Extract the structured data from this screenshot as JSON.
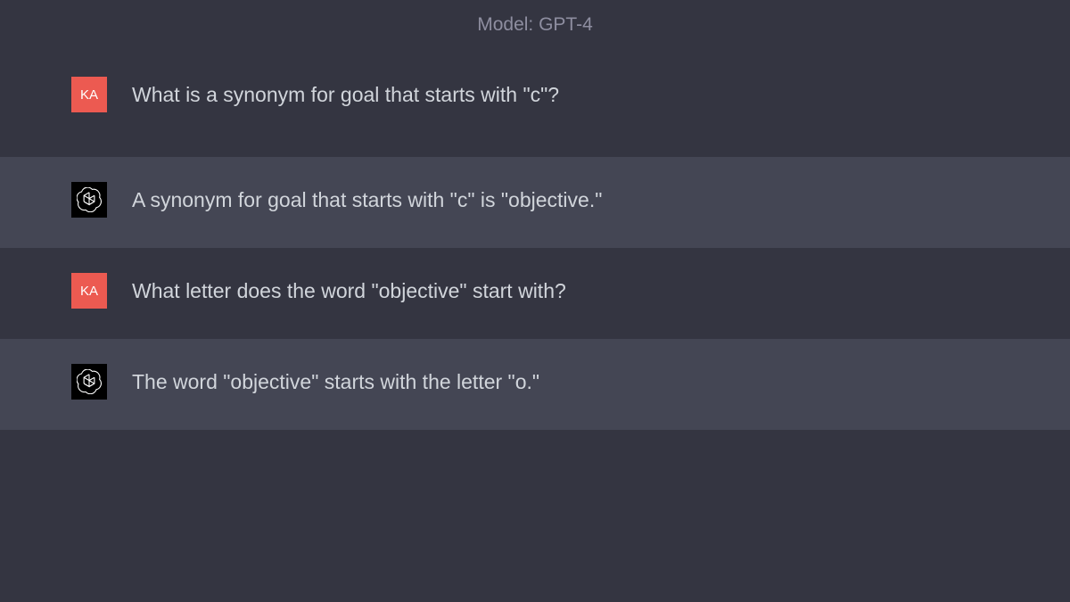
{
  "header": {
    "model_label": "Model: GPT-4"
  },
  "messages": [
    {
      "role": "user",
      "avatar_text": "KA",
      "text": "What is a synonym for goal that starts with \"c\"?"
    },
    {
      "role": "assistant",
      "avatar_icon": "openai-icon",
      "text": "A synonym for goal that starts with \"c\" is \"objective.\""
    },
    {
      "role": "user",
      "avatar_text": "KA",
      "text": "What letter does the word \"objective\" start with?"
    },
    {
      "role": "assistant",
      "avatar_icon": "openai-icon",
      "text": "The word \"objective\" starts with the letter \"o.\""
    }
  ]
}
